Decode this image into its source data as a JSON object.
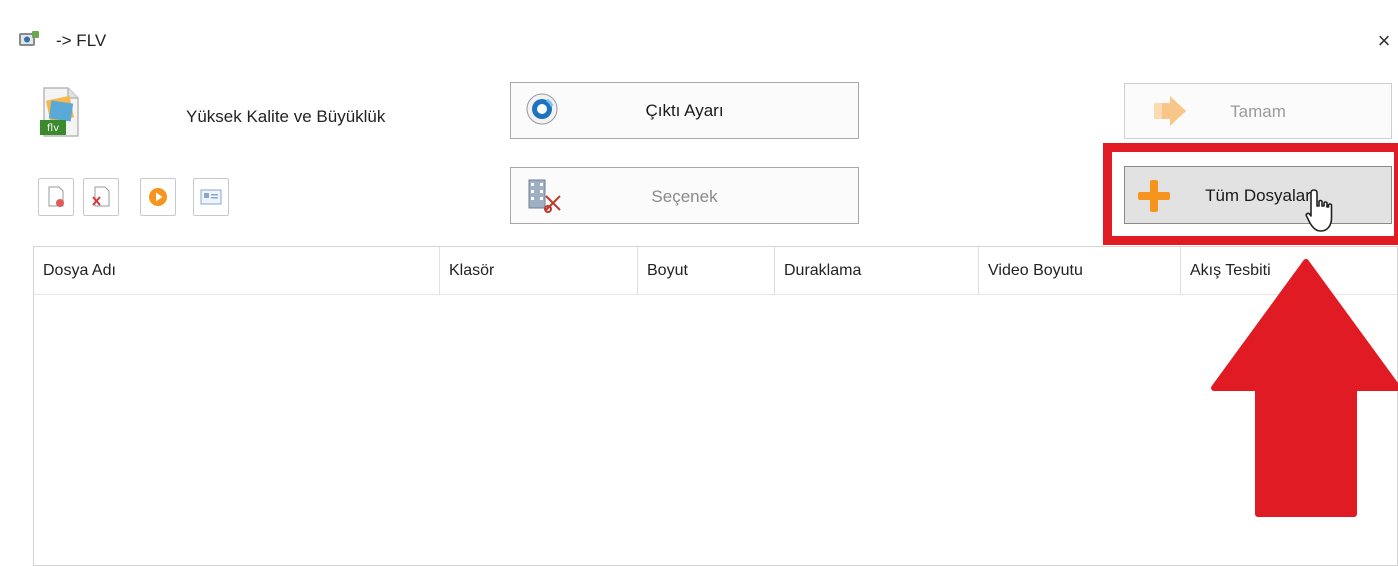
{
  "window": {
    "title": "-> FLV",
    "close_glyph": "×",
    "app_icon": "format-factory-icon"
  },
  "profile": {
    "icon": "flv-file-icon",
    "badge": "flv",
    "label": "Yüksek Kalite ve Büyüklük"
  },
  "toolbar": {
    "icons": [
      "add-file-icon",
      "remove-file-icon",
      "play-icon",
      "media-info-icon"
    ]
  },
  "buttons": {
    "output_settings": "Çıktı Ayarı",
    "options": "Seçenek",
    "ok": "Tamam",
    "all_files": "Tüm Dosyalar"
  },
  "table": {
    "columns": [
      "Dosya Adı",
      "Klasör",
      "Boyut",
      "Duraklama",
      "Video Boyutu",
      "Akış Tesbiti"
    ],
    "rows": []
  },
  "colors": {
    "annotation_red": "#e01b24",
    "orange_accent": "#f7941d"
  }
}
